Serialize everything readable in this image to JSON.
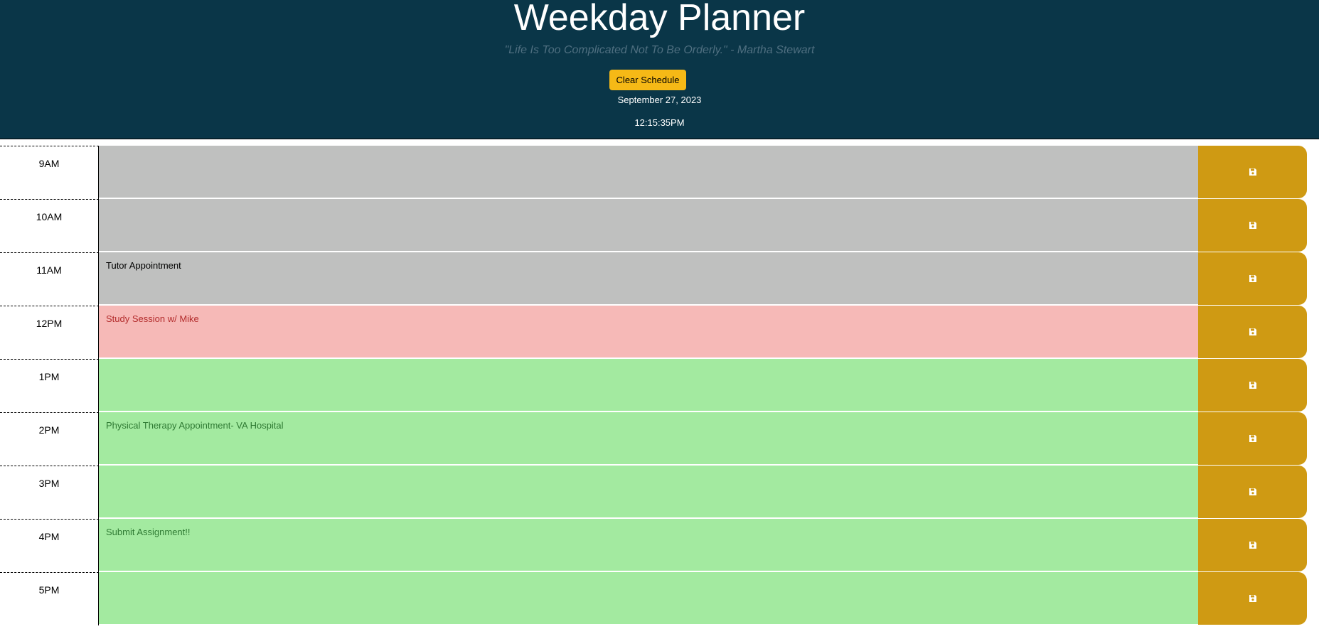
{
  "header": {
    "title": "Weekday Planner",
    "quote": "\"Life Is Too Complicated Not To Be Orderly.\" - Martha Stewart",
    "clear_label": "Clear Schedule",
    "date": "September 27, 2023",
    "time": "12:15:35PM"
  },
  "colors": {
    "header_bg": "#0a3648",
    "clear_button": "#f6b916",
    "past": "#bfc0bf",
    "present": "#f6b9b7",
    "future": "#a3eaa0",
    "save_button": "#cf9a13"
  },
  "icons": {
    "save": "floppy-disk-icon"
  },
  "schedule": [
    {
      "hour": "9AM",
      "text": "",
      "status": "past"
    },
    {
      "hour": "10AM",
      "text": "",
      "status": "past"
    },
    {
      "hour": "11AM",
      "text": "Tutor Appointment",
      "status": "past"
    },
    {
      "hour": "12PM",
      "text": "Study Session w/ Mike",
      "status": "present"
    },
    {
      "hour": "1PM",
      "text": "",
      "status": "future"
    },
    {
      "hour": "2PM",
      "text": "Physical Therapy Appointment- VA Hospital",
      "status": "future"
    },
    {
      "hour": "3PM",
      "text": "",
      "status": "future"
    },
    {
      "hour": "4PM",
      "text": "Submit Assignment!!",
      "status": "future"
    },
    {
      "hour": "5PM",
      "text": "",
      "status": "future"
    }
  ]
}
